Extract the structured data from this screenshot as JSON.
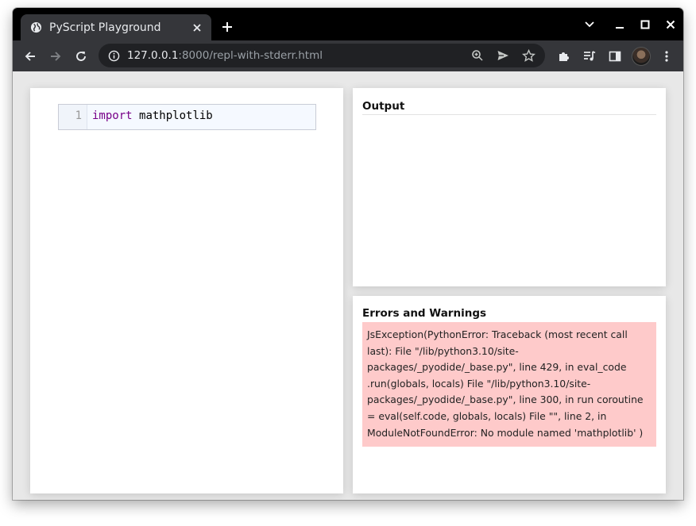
{
  "browser": {
    "tab_title": "PyScript Playground",
    "url_host": "127.0.0.1",
    "url_rest": ":8000/repl-with-stderr.html"
  },
  "editor": {
    "line_number": "1",
    "keyword": "import",
    "module": "mathplotlib"
  },
  "output": {
    "title": "Output"
  },
  "errors": {
    "title": "Errors and Warnings",
    "message": "JsException(PythonError: Traceback (most recent call last): File \"/lib/python3.10/site-packages/_pyodide/_base.py\", line 429, in eval_code .run(globals, locals) File \"/lib/python3.10/site-packages/_pyodide/_base.py\", line 300, in run coroutine = eval(self.code, globals, locals) File \"\", line 2, in ModuleNotFoundError: No module named 'mathplotlib' )"
  },
  "colors": {
    "tab_bg": "#35363a",
    "titlebar_bg": "#000000",
    "error_bg": "#fecaca",
    "keyword": "#770088"
  }
}
